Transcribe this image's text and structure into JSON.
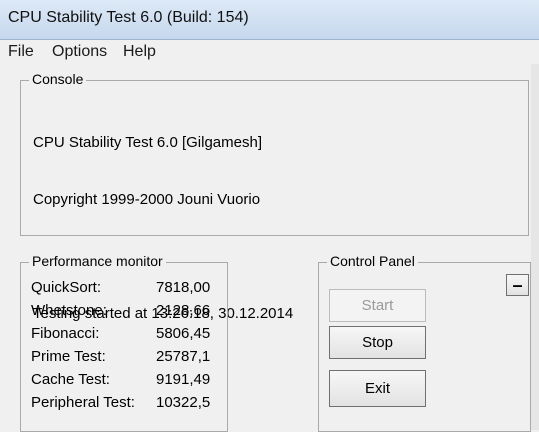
{
  "window": {
    "title": "CPU Stability Test 6.0 (Build: 154)"
  },
  "menu": [
    "File",
    "Options",
    "Help"
  ],
  "console": {
    "label": "Console",
    "lines": [
      "CPU Stability Test 6.0 [Gilgamesh]",
      "Copyright 1999-2000 Jouni Vuorio",
      "",
      "Testing started at 13:26:18, 30.12.2014"
    ]
  },
  "performance": {
    "label": "Performance monitor",
    "rows": [
      {
        "name": "QuickSort:",
        "value": "7818,00"
      },
      {
        "name": "Whetstone:",
        "value": "2128,66"
      },
      {
        "name": "Fibonacci:",
        "value": "5806,45"
      },
      {
        "name": "Prime Test:",
        "value": "25787,1"
      },
      {
        "name": "Cache Test:",
        "value": "9191,49"
      },
      {
        "name": "Peripheral Test:",
        "value": "10322,5"
      }
    ]
  },
  "control": {
    "label": "Control Panel",
    "start": "Start",
    "stop": "Stop",
    "exit": "Exit",
    "minimize": "–"
  }
}
